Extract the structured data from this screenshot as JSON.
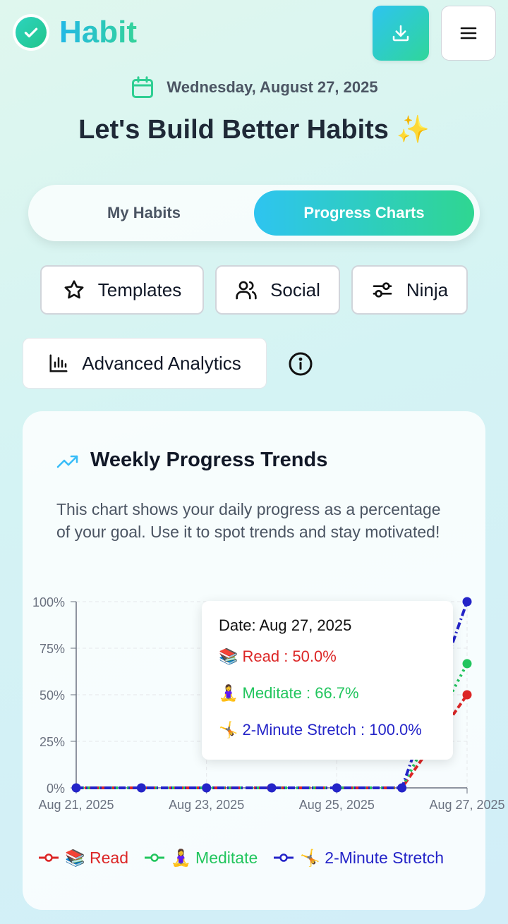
{
  "header": {
    "brand": "Habit",
    "logo_icon": "check-circle-icon",
    "download_icon": "download-icon",
    "menu_icon": "hamburger-menu-icon"
  },
  "date": "Wednesday, August 27, 2025",
  "headline": "Let's Build Better Habits ✨",
  "tabs": [
    {
      "label": "My Habits",
      "active": false
    },
    {
      "label": "Progress Charts",
      "active": true
    }
  ],
  "quick_actions": [
    {
      "label": "Templates",
      "icon": "star-icon"
    },
    {
      "label": "Social",
      "icon": "users-icon"
    },
    {
      "label": "Ninja",
      "icon": "sliders-icon"
    }
  ],
  "analytics": {
    "label": "Advanced Analytics",
    "icon": "bar-chart-icon",
    "info_icon": "info-icon"
  },
  "card": {
    "title": "Weekly Progress Trends",
    "description": "This chart shows your daily progress as a percentage of your goal. Use it to spot trends and stay motivated!"
  },
  "tooltip": {
    "date": "Date: Aug 27, 2025",
    "lines": [
      "📚 Read : 50.0%",
      "🧘‍♀️ Meditate : 66.7%",
      "🤸 2-Minute Stretch : 100.0%"
    ]
  },
  "legend": [
    "📚 Read",
    "🧘‍♀️ Meditate",
    "🤸 2-Minute Stretch"
  ],
  "colors": {
    "read": "#dc2626",
    "meditate": "#22c55e",
    "stretch": "#2424c8",
    "accent_start": "#2ec4f0",
    "accent_end": "#2fd691"
  },
  "chart_data": {
    "type": "line",
    "x": [
      "Aug 21, 2025",
      "Aug 22, 2025",
      "Aug 23, 2025",
      "Aug 24, 2025",
      "Aug 25, 2025",
      "Aug 26, 2025",
      "Aug 27, 2025"
    ],
    "x_tick_labels": [
      "Aug 21, 2025",
      "Aug 23, 2025",
      "Aug 25, 2025",
      "Aug 27, 2025"
    ],
    "y_tick_labels": [
      "0%",
      "25%",
      "50%",
      "75%",
      "100%"
    ],
    "ylim": [
      0,
      100
    ],
    "grid": true,
    "legend_position": "bottom",
    "series": [
      {
        "name": "📚 Read",
        "values": [
          0,
          0,
          0,
          0,
          0,
          0,
          50.0
        ]
      },
      {
        "name": "🧘‍♀️ Meditate",
        "values": [
          0,
          0,
          0,
          0,
          0,
          0,
          66.7
        ]
      },
      {
        "name": "🤸 2-Minute Stretch",
        "values": [
          0,
          0,
          0,
          0,
          0,
          0,
          100.0
        ]
      }
    ]
  }
}
